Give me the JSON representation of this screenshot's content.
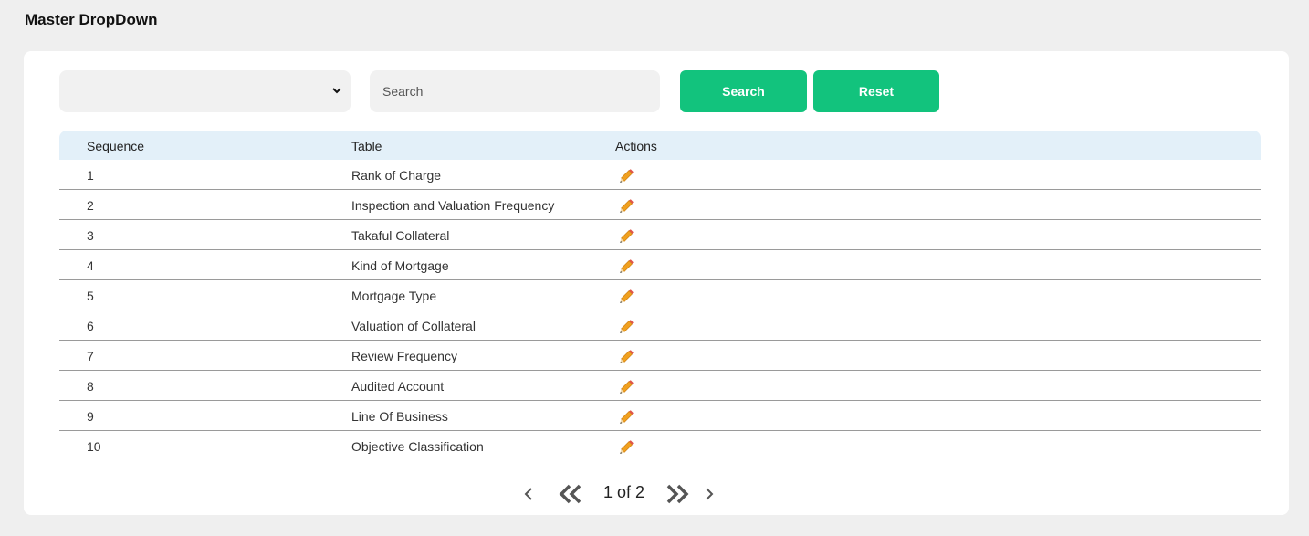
{
  "page": {
    "title": "Master DropDown"
  },
  "filters": {
    "select_value": "",
    "search_placeholder": "Search",
    "search_value": "",
    "search_button": "Search",
    "reset_button": "Reset"
  },
  "table": {
    "headers": {
      "sequence": "Sequence",
      "table": "Table",
      "actions": "Actions"
    },
    "rows": [
      {
        "sequence": "1",
        "table": "Rank of Charge"
      },
      {
        "sequence": "2",
        "table": "Inspection and Valuation Frequency"
      },
      {
        "sequence": "3",
        "table": "Takaful Collateral"
      },
      {
        "sequence": "4",
        "table": "Kind of Mortgage"
      },
      {
        "sequence": "5",
        "table": "Mortgage Type"
      },
      {
        "sequence": "6",
        "table": "Valuation of Collateral"
      },
      {
        "sequence": "7",
        "table": "Review Frequency"
      },
      {
        "sequence": "8",
        "table": "Audited Account"
      },
      {
        "sequence": "9",
        "table": "Line Of Business"
      },
      {
        "sequence": "10",
        "table": "Objective Classification"
      }
    ],
    "row_action_icon": "pencil-edit-icon"
  },
  "pagination": {
    "text": "1 of 2"
  },
  "colors": {
    "accent": "#12c37d",
    "header_bg": "#e3f0f9",
    "page_bg": "#efefef"
  }
}
